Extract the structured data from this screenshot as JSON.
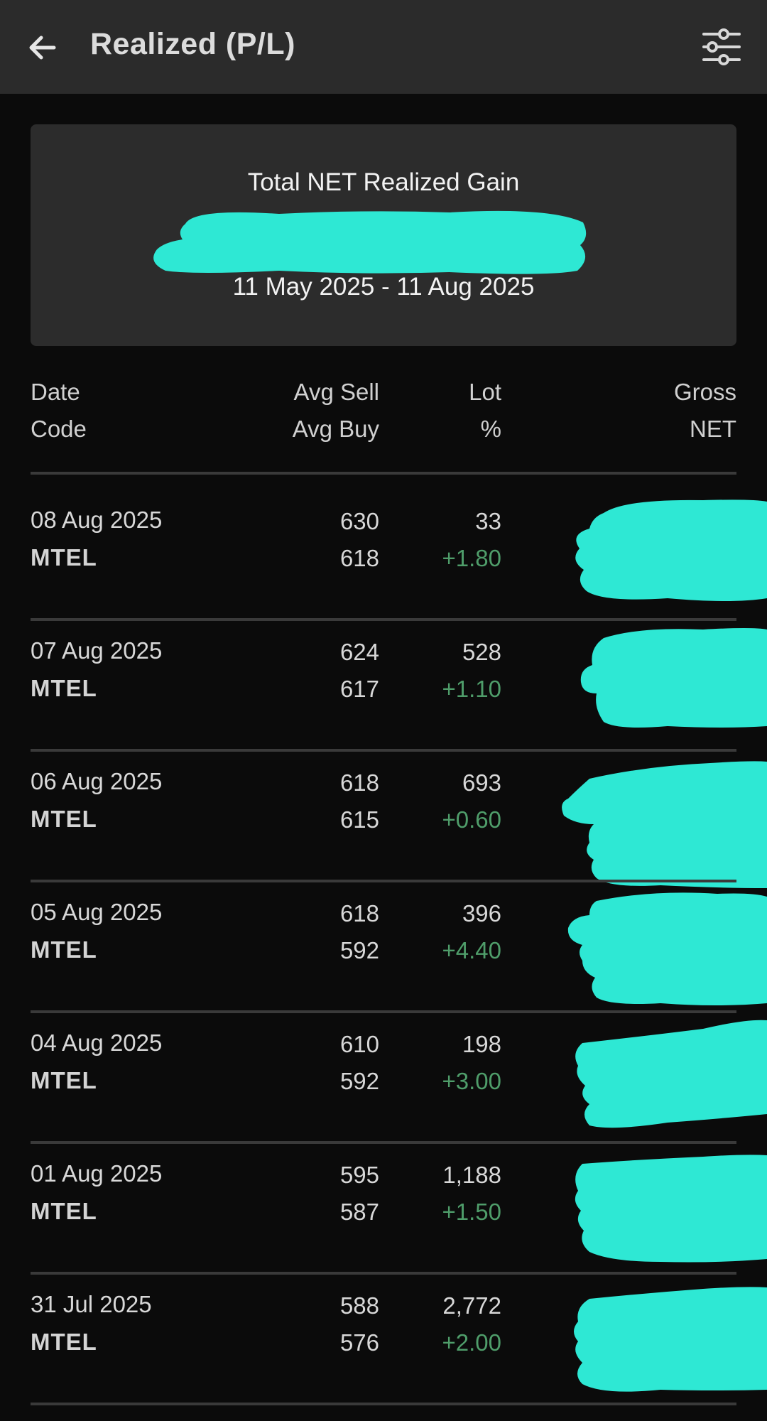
{
  "header": {
    "title": "Realized (P/L)",
    "back_icon": "arrow-left-icon",
    "filter_icon": "sliders-icon"
  },
  "summary": {
    "label": "Total NET Realized Gain",
    "date_range": "11 May 2025 - 11 Aug 2025"
  },
  "columns": {
    "date": "Date",
    "code": "Code",
    "avg_sell": "Avg Sell",
    "avg_buy": "Avg Buy",
    "lot": "Lot",
    "percent": "%",
    "gross": "Gross",
    "net": "NET"
  },
  "rows": [
    {
      "date": "08 Aug 2025",
      "code": "MTEL",
      "avg_sell": "630",
      "avg_buy": "618",
      "lot": "33",
      "pct": "+1.80"
    },
    {
      "date": "07 Aug 2025",
      "code": "MTEL",
      "avg_sell": "624",
      "avg_buy": "617",
      "lot": "528",
      "pct": "+1.10"
    },
    {
      "date": "06 Aug 2025",
      "code": "MTEL",
      "avg_sell": "618",
      "avg_buy": "615",
      "lot": "693",
      "pct": "+0.60"
    },
    {
      "date": "05 Aug 2025",
      "code": "MTEL",
      "avg_sell": "618",
      "avg_buy": "592",
      "lot": "396",
      "pct": "+4.40"
    },
    {
      "date": "04 Aug 2025",
      "code": "MTEL",
      "avg_sell": "610",
      "avg_buy": "592",
      "lot": "198",
      "pct": "+3.00"
    },
    {
      "date": "01 Aug 2025",
      "code": "MTEL",
      "avg_sell": "595",
      "avg_buy": "587",
      "lot": "1,188",
      "pct": "+1.50"
    },
    {
      "date": "31 Jul 2025",
      "code": "MTEL",
      "avg_sell": "588",
      "avg_buy": "576",
      "lot": "2,772",
      "pct": "+2.00"
    }
  ],
  "colors": {
    "background": "#0b0b0b",
    "topbar": "#2b2b2b",
    "card": "#2c2c2c",
    "positive": "#4f9d6a",
    "redaction": "#2ee8d4"
  }
}
